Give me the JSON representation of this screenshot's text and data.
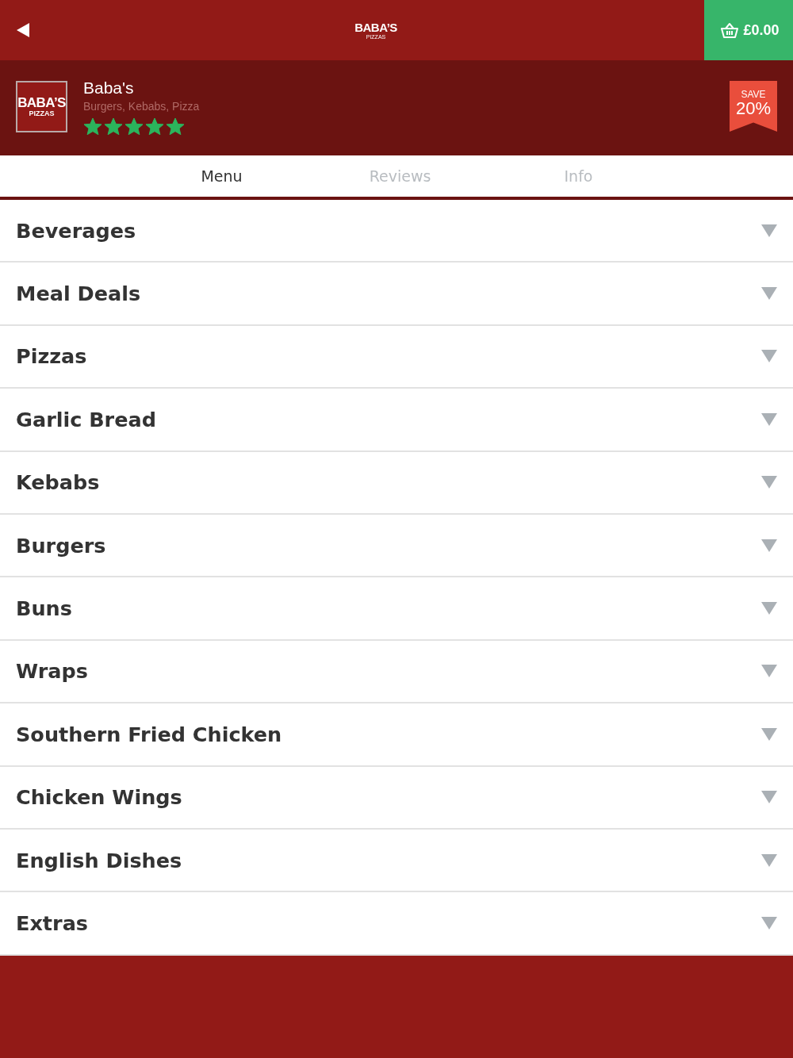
{
  "top_bar": {
    "logo": {
      "line_1": "BABA’S",
      "line_2": "PIZZAS"
    },
    "cart_total": "£0.00"
  },
  "restaurant": {
    "logo": {
      "line_1": "BABA’S",
      "line_2": "PIZZAS"
    },
    "name": "Baba's",
    "cuisines": "Burgers, Kebabs, Pizza",
    "stars": 5,
    "offer": {
      "label": "SAVE",
      "value": "20%"
    }
  },
  "tabs": [
    {
      "label": "Menu",
      "selected": true
    },
    {
      "label": "Reviews",
      "selected": false
    },
    {
      "label": "Info",
      "selected": false
    }
  ],
  "categories": [
    {
      "name": "Beverages",
      "expanded": false
    },
    {
      "name": "Meal Deals",
      "expanded": false
    },
    {
      "name": "Pizzas",
      "expanded": false
    },
    {
      "name": "Garlic Bread",
      "expanded": false
    },
    {
      "name": "Kebabs",
      "expanded": false
    },
    {
      "name": "Burgers",
      "expanded": false
    },
    {
      "name": "Buns",
      "expanded": false
    },
    {
      "name": "Wraps",
      "expanded": false
    },
    {
      "name": "Southern Fried Chicken",
      "expanded": false
    },
    {
      "name": "Chicken Wings",
      "expanded": false
    },
    {
      "name": "English Dishes",
      "expanded": false
    },
    {
      "name": "Extras",
      "expanded": false
    }
  ]
}
